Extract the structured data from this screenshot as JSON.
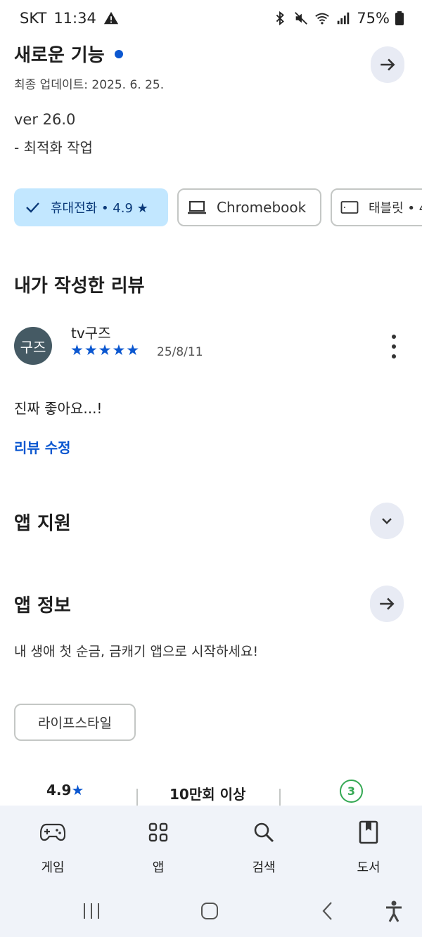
{
  "status_bar": {
    "carrier": "SKT",
    "time": "11:34",
    "battery": "75%",
    "icons": [
      "alert-icon",
      "bluetooth-icon",
      "mute-icon",
      "wifi-icon",
      "signal-icon",
      "battery-icon"
    ]
  },
  "whats_new": {
    "title": "새로운 기능",
    "updated": "최종 업데이트: 2025. 6. 25.",
    "version": "ver 26.0",
    "notes": "- 최적화 작업"
  },
  "devices": {
    "phone_label": "휴대전화 • 4.9 ★",
    "chromebook_label": "Chromebook",
    "tablet_label": "태블릿 • 4"
  },
  "my_review": {
    "section_title": "내가 작성한 리뷰",
    "avatar_initials": "구즈",
    "author": "tv구즈",
    "stars": "★★★★★",
    "rating": 5,
    "date": "25/8/11",
    "text": "진짜 좋아요...!",
    "edit_label": "리뷰 수정"
  },
  "app_support": {
    "title": "앱 지원"
  },
  "app_info": {
    "title": "앱 정보",
    "description": "내 생애 첫 순금, 금캐기 앱으로 시작하세요!",
    "category": "라이프스타일"
  },
  "stats": {
    "rating": "4.9",
    "rating_star": "★",
    "downloads": "10만회 이상",
    "age_rating": "3"
  },
  "bottom_nav": {
    "items": [
      {
        "label": "게임",
        "icon": "gamepad-icon"
      },
      {
        "label": "앱",
        "icon": "apps-grid-icon"
      },
      {
        "label": "검색",
        "icon": "search-icon"
      },
      {
        "label": "도서",
        "icon": "book-icon"
      }
    ]
  },
  "colors": {
    "accent": "#0b57d0",
    "chip_selected_bg": "#c2e7ff",
    "round_button_bg": "#e8ebf4",
    "nav_bg": "#f0f3f9",
    "age_badge": "#34a853"
  }
}
